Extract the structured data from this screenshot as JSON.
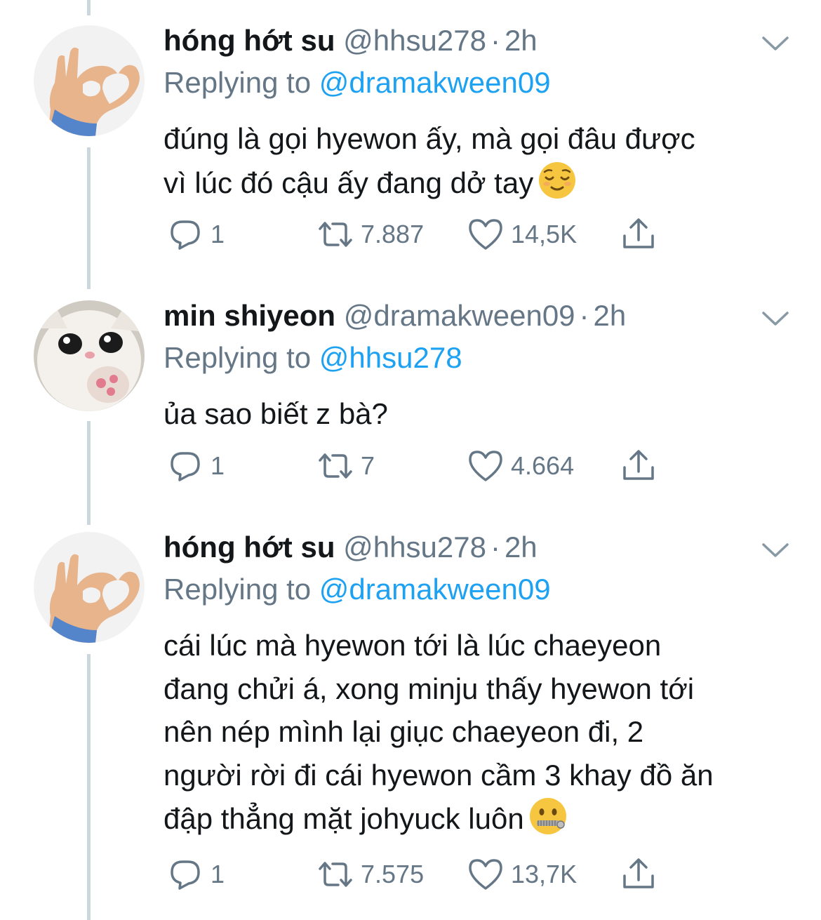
{
  "tweets": [
    {
      "author_name": "hóng hớt su",
      "handle": "@hhsu278",
      "separator": "·",
      "time": "2h",
      "replying_label": "Replying to",
      "replying_to": "@dramakween09",
      "text_lines": [
        "đúng là gọi hyewon ấy, mà gọi đâu được",
        "vì lúc đó cậu ấy đang dở tay"
      ],
      "emoji": "relieved-face",
      "replies": "1",
      "retweets": "7.887",
      "likes": "14,5K",
      "avatar": "hand-heart-gesture"
    },
    {
      "author_name": "min shiyeon",
      "handle": "@dramakween09",
      "separator": "·",
      "time": "2h",
      "replying_label": "Replying to",
      "replying_to": "@hhsu278",
      "text_lines": [
        "ủa sao biết z bà?"
      ],
      "emoji": "",
      "replies": "1",
      "retweets": "7",
      "likes": "4.664",
      "avatar": "crying-cat"
    },
    {
      "author_name": "hóng hớt su",
      "handle": "@hhsu278",
      "separator": "·",
      "time": "2h",
      "replying_label": "Replying to",
      "replying_to": "@dramakween09",
      "text_lines": [
        "cái lúc mà hyewon tới là lúc chaeyeon",
        "đang chửi á, xong minju thấy hyewon tới",
        "nên nép mình lại giục chaeyeon đi, 2",
        "người rời đi cái hyewon cầm 3 khay đồ ăn",
        "đập thẳng mặt johyuck luôn"
      ],
      "emoji": "zipper-mouth-face",
      "replies": "1",
      "retweets": "7.575",
      "likes": "13,7K",
      "avatar": "hand-heart-gesture"
    }
  ],
  "colors": {
    "text": "#14171a",
    "secondary": "#657786",
    "link": "#1da1f2",
    "thread_line": "#ccd6dd"
  },
  "icons": [
    "chevron-down-icon",
    "reply-icon",
    "retweet-icon",
    "like-icon",
    "share-icon"
  ]
}
